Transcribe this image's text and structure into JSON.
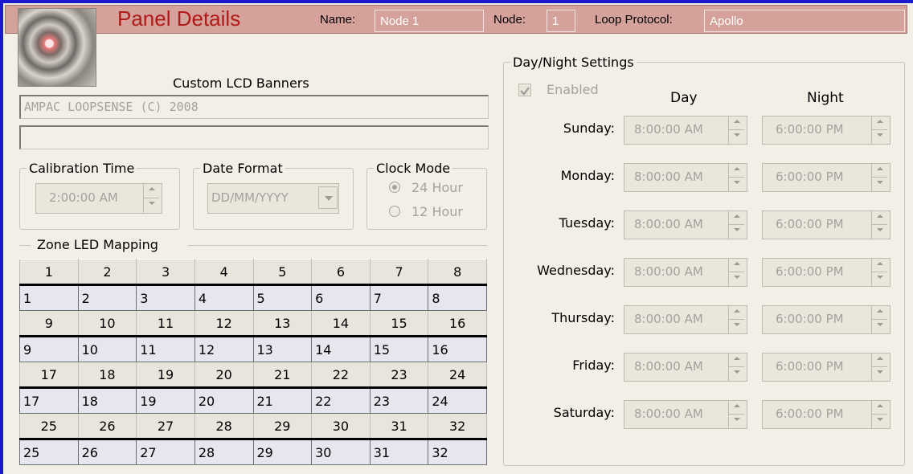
{
  "header": {
    "title": "Panel Details",
    "name_label": "Name:",
    "name_value": "Node 1",
    "node_label": "Node:",
    "node_value": "1",
    "protocol_label": "Loop Protocol:",
    "protocol_value": "Apollo"
  },
  "banners": {
    "caption": "Custom LCD Banners",
    "line1": "AMPAC LOOPSENSE (C) 2008",
    "line2": ""
  },
  "calibration": {
    "legend": "Calibration Time",
    "value": "2:00:00 AM"
  },
  "date_format": {
    "legend": "Date Format",
    "value": "DD/MM/YYYY"
  },
  "clock_mode": {
    "legend": "Clock Mode",
    "options": [
      "24 Hour",
      "12 Hour"
    ],
    "selected": "24 Hour"
  },
  "zone_mapping": {
    "legend": "Zone LED Mapping",
    "rows": [
      {
        "headers": [
          "1",
          "2",
          "3",
          "4",
          "5",
          "6",
          "7",
          "8"
        ],
        "values": [
          "1",
          "2",
          "3",
          "4",
          "5",
          "6",
          "7",
          "8"
        ]
      },
      {
        "headers": [
          "9",
          "10",
          "11",
          "12",
          "13",
          "14",
          "15",
          "16"
        ],
        "values": [
          "9",
          "10",
          "11",
          "12",
          "13",
          "14",
          "15",
          "16"
        ]
      },
      {
        "headers": [
          "17",
          "18",
          "19",
          "20",
          "21",
          "22",
          "23",
          "24"
        ],
        "values": [
          "17",
          "18",
          "19",
          "20",
          "21",
          "22",
          "23",
          "24"
        ]
      },
      {
        "headers": [
          "25",
          "26",
          "27",
          "28",
          "29",
          "30",
          "31",
          "32"
        ],
        "values": [
          "25",
          "26",
          "27",
          "28",
          "29",
          "30",
          "31",
          "32"
        ]
      }
    ]
  },
  "day_night": {
    "legend": "Day/Night Settings",
    "enabled_label": "Enabled",
    "enabled": true,
    "day_header": "Day",
    "night_header": "Night",
    "days": [
      {
        "label": "Sunday:",
        "day": "8:00:00 AM",
        "night": "6:00:00 PM"
      },
      {
        "label": "Monday:",
        "day": "8:00:00 AM",
        "night": "6:00:00 PM"
      },
      {
        "label": "Tuesday:",
        "day": "8:00:00 AM",
        "night": "6:00:00 PM"
      },
      {
        "label": "Wednesday:",
        "day": "8:00:00 AM",
        "night": "6:00:00 PM"
      },
      {
        "label": "Thursday:",
        "day": "8:00:00 AM",
        "night": "6:00:00 PM"
      },
      {
        "label": "Friday:",
        "day": "8:00:00 AM",
        "night": "6:00:00 PM"
      },
      {
        "label": "Saturday:",
        "day": "8:00:00 AM",
        "night": "6:00:00 PM"
      }
    ]
  },
  "colors": {
    "header_band": "#d4a29a",
    "title": "#b11a1a",
    "frame": "#1a1acc",
    "disabled_text": "#a3a29c"
  }
}
